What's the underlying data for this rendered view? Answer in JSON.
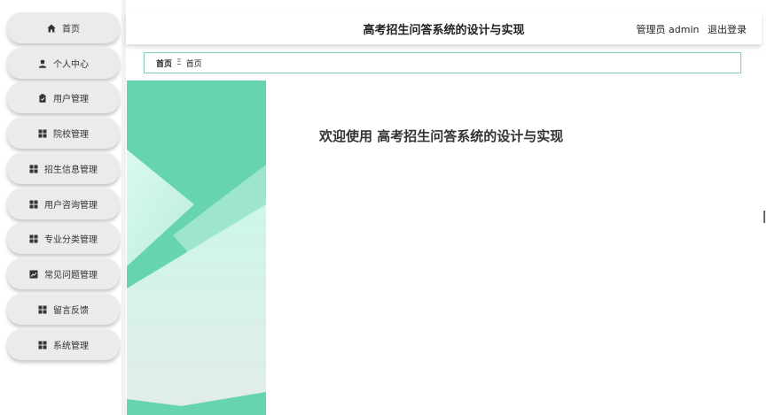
{
  "sidebar": {
    "items": [
      {
        "label": "首页",
        "icon": "home-icon"
      },
      {
        "label": "个人中心",
        "icon": "user-icon"
      },
      {
        "label": "用户管理",
        "icon": "clipboard-icon"
      },
      {
        "label": "院校管理",
        "icon": "grid-icon"
      },
      {
        "label": "招生信息管理",
        "icon": "grid-icon"
      },
      {
        "label": "用户咨询管理",
        "icon": "grid-icon"
      },
      {
        "label": "专业分类管理",
        "icon": "grid-icon"
      },
      {
        "label": "常见问题管理",
        "icon": "chart-icon"
      },
      {
        "label": "留言反馈",
        "icon": "grid-icon"
      },
      {
        "label": "系统管理",
        "icon": "grid-icon"
      }
    ]
  },
  "header": {
    "title": "高考招生问答系统的设计与实现",
    "user": "管理员 admin",
    "logout": "退出登录"
  },
  "breadcrumb": {
    "home": "首页",
    "separator": "Ξ",
    "current": "首页"
  },
  "main": {
    "welcome": "欢迎使用 高考招生问答系统的设计与实现"
  },
  "colors": {
    "accent": "#66d3b1",
    "light_accent": "#c8f3e6",
    "breadcrumb_border": "#7fd1b4"
  }
}
